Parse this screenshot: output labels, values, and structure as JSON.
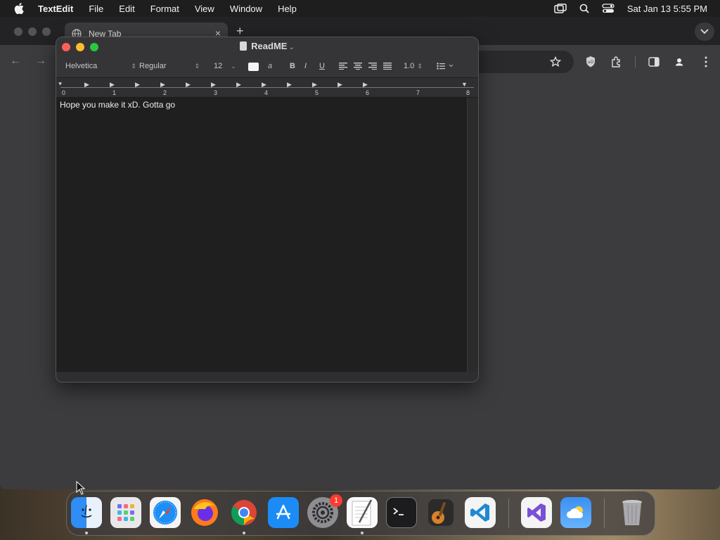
{
  "menubar": {
    "app_name": "TextEdit",
    "items": [
      "File",
      "Edit",
      "Format",
      "View",
      "Window",
      "Help"
    ],
    "datetime": "Sat Jan 13  5:55 PM",
    "icons": [
      "apple-icon",
      "screen-mirroring-icon",
      "spotlight-icon",
      "control-center-icon"
    ]
  },
  "browser": {
    "tab_title": "New Tab",
    "new_tab_label": "+",
    "close_label": "×",
    "back_label": "←",
    "forward_label": "→"
  },
  "textedit": {
    "title": "ReadME",
    "font_family": "Helvetica",
    "font_style": "Regular",
    "font_size": "12",
    "line_spacing": "1.0",
    "bold_label": "B",
    "italic_label": "I",
    "underline_label": "U",
    "ruler_numbers": [
      "0",
      "1",
      "2",
      "3",
      "4",
      "5",
      "6",
      "7",
      "8"
    ],
    "body_text": "Hope you make it xD. Gotta go"
  },
  "dock": {
    "apps": [
      "Finder",
      "Launchpad",
      "Safari",
      "Firefox",
      "Chrome",
      "App Store",
      "System Settings",
      "TextEdit",
      "Terminal",
      "GarageBand",
      "VS Code",
      "Visual Studio",
      "Weather",
      "Trash"
    ],
    "settings_badge": "1"
  },
  "colors": {
    "menubar_bg": "#1e1e1e",
    "window_bg": "#2b2b2b",
    "close_red": "#ff5f57",
    "minimize_yellow": "#febc2e",
    "zoom_green": "#28c840",
    "badge_red": "#ff3b30"
  }
}
